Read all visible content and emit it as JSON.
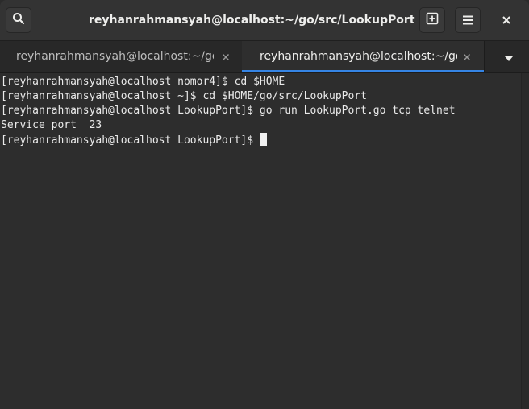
{
  "window": {
    "title": "reyhanrahmansyah@localhost:~/go/src/LookupPort"
  },
  "header": {
    "search_icon": "search-icon",
    "new_tab_icon": "new-tab-icon",
    "menu_icon": "hamburger-menu-icon",
    "close_icon": "close-icon"
  },
  "tabs": [
    {
      "label": "reyhanrahmansyah@localhost:~/go/src/LookupPort",
      "active": false
    },
    {
      "label": "reyhanrahmansyah@localhost:~/go/src/LookupPort",
      "active": true
    }
  ],
  "terminal": {
    "lines": [
      "[reyhanrahmansyah@localhost nomor4]$ cd $HOME",
      "[reyhanrahmansyah@localhost ~]$ cd $HOME/go/src/LookupPort",
      "[reyhanrahmansyah@localhost LookupPort]$ go run LookupPort.go tcp telnet",
      "Service port  23",
      "[reyhanrahmansyah@localhost LookupPort]$ "
    ]
  },
  "colors": {
    "accent": "#3584e4",
    "background": "#2d2d2d",
    "foreground": "#eaeaea"
  }
}
